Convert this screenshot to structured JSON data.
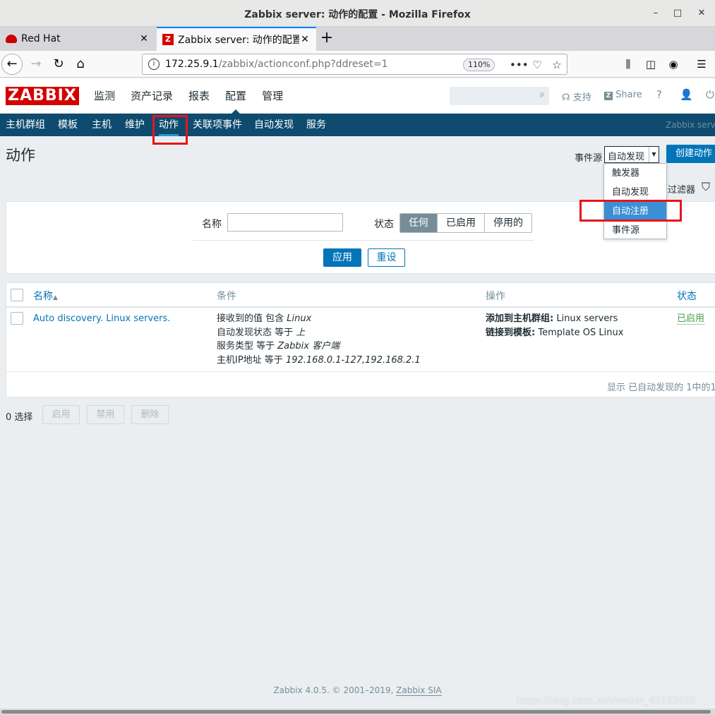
{
  "window": {
    "title": "Zabbix server: 动作的配置 - Mozilla Firefox",
    "minimize": "–",
    "maximize": "□",
    "close": "✕"
  },
  "tabs": [
    {
      "label": "Red Hat",
      "close": "✕"
    },
    {
      "label": "Zabbix server: 动作的配置",
      "close": "✕"
    }
  ],
  "new_tab": "+",
  "urlbar": {
    "host": "172.25.9.1",
    "path": "/zabbix/actionconf.php?ddreset=1",
    "zoom": "110%"
  },
  "zabbix": {
    "logo": "ZABBIX",
    "menu": [
      "监测",
      "资产记录",
      "报表",
      "配置",
      "管理"
    ],
    "support": "支持",
    "share": "Share",
    "help": "?",
    "submenu": [
      "主机群组",
      "模板",
      "主机",
      "维护",
      "动作",
      "关联项事件",
      "自动发现",
      "服务"
    ],
    "server_name": "Zabbix server"
  },
  "page": {
    "title": "动作",
    "event_source_label": "事件源",
    "event_source_value": "自动发现",
    "create_button": "创建动作",
    "filter_tab": "过滤器",
    "dropdown_options": [
      "触发器",
      "自动发现",
      "自动注册",
      "事件源"
    ]
  },
  "filter": {
    "name_label": "名称",
    "name_value": "",
    "status_label": "状态",
    "status_options": [
      "任何",
      "已启用",
      "停用的"
    ],
    "apply": "应用",
    "reset": "重设"
  },
  "table": {
    "headers": {
      "name": "名称",
      "conditions": "条件",
      "operations": "操作",
      "status": "状态"
    },
    "sort_arrow": "▲",
    "row": {
      "name": "Auto discovery. Linux servers.",
      "conditions": [
        {
          "text": "接收到的值 包含 ",
          "value": "Linux"
        },
        {
          "text": "自动发现状态 等于 ",
          "value": "上"
        },
        {
          "text": "服务类型 等于 ",
          "value": "Zabbix 客户端"
        },
        {
          "text": "主机IP地址 等于 ",
          "value": "192.168.0.1-127,192.168.2.1"
        }
      ],
      "operations": [
        {
          "label": "添加到主机群组:",
          "value": " Linux servers"
        },
        {
          "label": "链接到模板:",
          "value": " Template OS Linux"
        }
      ],
      "status": "已启用"
    },
    "footer": "显示 已自动发现的 1中的1"
  },
  "mass_actions": {
    "selected": "0 选择",
    "enable": "启用",
    "disable": "禁用",
    "delete": "删除"
  },
  "footer": {
    "text": "Zabbix 4.0.5. © 2001–2019, ",
    "company": "Zabbix SIA"
  },
  "watermark": "https://blog.csdn.net/weixin_45233090",
  "colors": {
    "accent": "#0275b8",
    "subnav_bg": "#0e4b6f",
    "logo_red": "#d40000",
    "enabled_green": "#429e47",
    "annotation_red": "#e4161b"
  }
}
